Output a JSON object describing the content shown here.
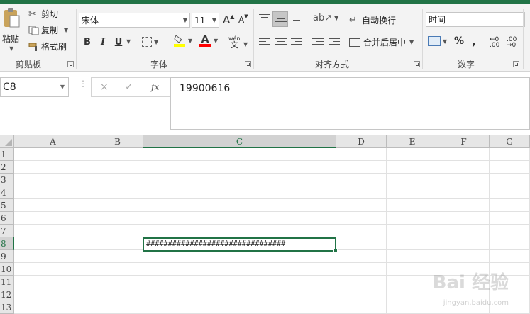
{
  "ribbon": {
    "clipboard": {
      "paste_label": "粘贴",
      "cut_label": "剪切",
      "copy_label": "复制",
      "format_painter_label": "格式刷",
      "group_label": "剪贴板"
    },
    "font": {
      "font_name": "宋体",
      "font_size": "11",
      "bold": "B",
      "italic": "I",
      "underline": "U",
      "phonetic_top": "wén",
      "phonetic_bottom": "文",
      "font_color_letter": "A",
      "increase_size": "A",
      "decrease_size": "A",
      "group_label": "字体"
    },
    "alignment": {
      "wrap_text_label": "自动换行",
      "merge_center_label": "合并后居中",
      "group_label": "对齐方式"
    },
    "number": {
      "format_value": "时间",
      "percent": "%",
      "comma": ",",
      "group_label": "数字"
    },
    "colors": {
      "accent": "#217346",
      "fill_yellow": "#ffff00",
      "font_red": "#ff0000"
    }
  },
  "formula_bar": {
    "name_box": "C8",
    "formula_value": "19900616",
    "cancel_icon": "×",
    "enter_icon": "✓",
    "fx_label": "fx"
  },
  "grid": {
    "columns": [
      "A",
      "B",
      "C",
      "D",
      "E",
      "F",
      "G"
    ],
    "rows": [
      "1",
      "2",
      "3",
      "4",
      "5",
      "6",
      "7",
      "8",
      "9",
      "10",
      "11",
      "12",
      "13"
    ],
    "selected_column": "C",
    "selected_row": "8",
    "active_cell_display": "################################"
  },
  "watermark": {
    "main": "Bai 经验",
    "sub": "jingyan.baidu.com"
  }
}
